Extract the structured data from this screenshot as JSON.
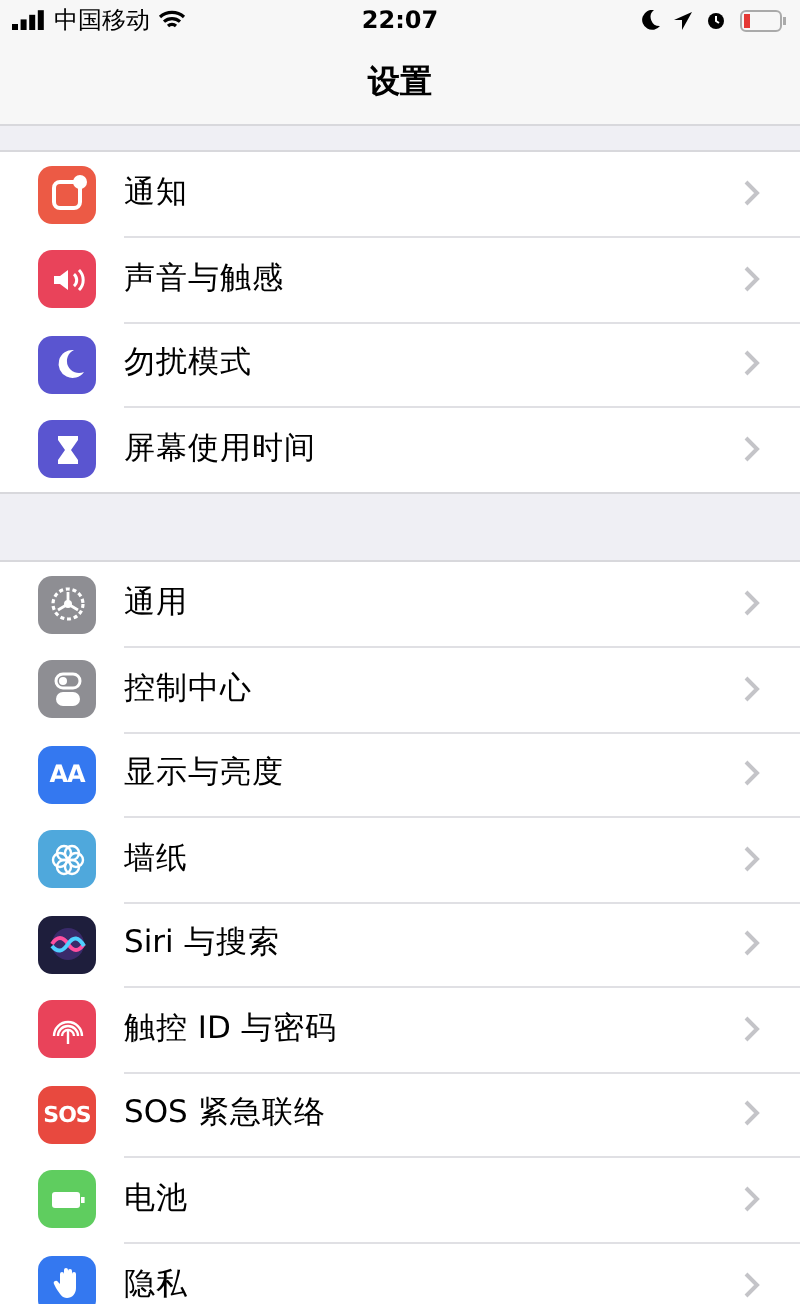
{
  "status_bar": {
    "carrier": "中国移动",
    "time": "22:07"
  },
  "nav": {
    "title": "设置"
  },
  "groups": [
    {
      "items": [
        {
          "label": "通知",
          "color": "#ec5a45"
        },
        {
          "label": "声音与触感",
          "color": "#e9435a"
        },
        {
          "label": "勿扰模式",
          "color": "#5a55d0"
        },
        {
          "label": "屏幕使用时间",
          "color": "#5a55d0"
        }
      ]
    },
    {
      "items": [
        {
          "label": "通用",
          "color": "#8e8e93"
        },
        {
          "label": "控制中心",
          "color": "#8e8e93"
        },
        {
          "label": "显示与亮度",
          "color": "#3478f0",
          "icon_text": "AA"
        },
        {
          "label": "墙纸",
          "color": "#4fa8dc"
        },
        {
          "label": "Siri 与搜索",
          "color": "#1e1e3c"
        },
        {
          "label": "触控 ID 与密码",
          "color": "#e9435a"
        },
        {
          "label": "SOS 紧急联络",
          "color": "#e8493f",
          "icon_text": "SOS"
        },
        {
          "label": "电池",
          "color": "#5fcd5f"
        },
        {
          "label": "隐私",
          "color": "#3478f0"
        }
      ]
    }
  ]
}
